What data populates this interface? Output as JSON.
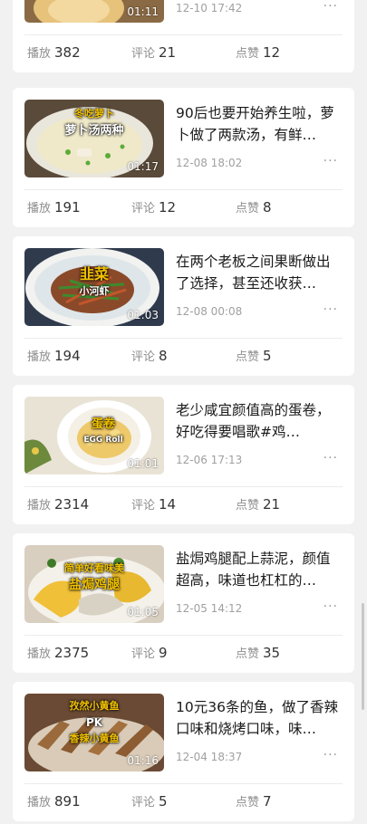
{
  "labels": {
    "plays": "播放",
    "comments": "评论",
    "likes": "点赞",
    "more": "···"
  },
  "videos": [
    {
      "title": "",
      "duration": "01:11",
      "date": "12-10 17:42",
      "plays": "382",
      "comments": "21",
      "likes": "12",
      "cover": ""
    },
    {
      "title": "90后也要开始养生啦，萝卜做了两款汤，有鲜…",
      "duration": "01:17",
      "date": "12-08 18:02",
      "plays": "191",
      "comments": "12",
      "likes": "8",
      "cover_line1": "冬吃萝卜",
      "cover_line2": "萝卜汤两种"
    },
    {
      "title": "在两个老板之间果断做出了选择，甚至还收获…",
      "duration": "01:03",
      "date": "12-08 00:08",
      "plays": "194",
      "comments": "8",
      "likes": "5",
      "cover_line1": "韭菜",
      "cover_line2": "小河虾"
    },
    {
      "title": "老少咸宜颜值高的蛋卷，好吃得要唱歌#鸡…",
      "duration": "01:01",
      "date": "12-06 17:13",
      "plays": "2314",
      "comments": "14",
      "likes": "21",
      "cover_line1": "蛋卷",
      "cover_line2": "EGG Roll"
    },
    {
      "title": "盐焗鸡腿配上蒜泥，颜值超高，味道也杠杠的…",
      "duration": "01:05",
      "date": "12-05 14:12",
      "plays": "2375",
      "comments": "9",
      "likes": "35",
      "cover_line1": "简单好看味美",
      "cover_line2": "盐焗鸡腿"
    },
    {
      "title": "10元36条的鱼，做了香辣口味和烧烤口味，味…",
      "duration": "01:16",
      "date": "12-04 18:37",
      "plays": "891",
      "comments": "5",
      "likes": "7",
      "cover_line1": "孜然小黄鱼",
      "cover_line2": "PK",
      "cover_line3": "香辣小黄鱼"
    }
  ],
  "colors": {
    "background": "#f1f1f1",
    "card": "#ffffff",
    "cover_text_gold": "#f2c200",
    "cover_text_white": "#ffffff"
  }
}
